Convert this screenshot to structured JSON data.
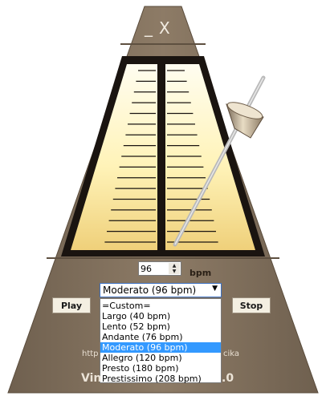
{
  "window": {
    "minimize_label": "_",
    "close_label": "X"
  },
  "tempo": {
    "value": "96",
    "unit": "bpm",
    "min_bpm": 40,
    "max_bpm": 208
  },
  "tempo_select": {
    "selected": "Moderato (96 bpm)",
    "arrow": "▼",
    "options": [
      "=Custom=",
      "Largo (40 bpm)",
      "Lento (52 bpm)",
      "Andante (76 bpm)",
      "Moderato (96 bpm)",
      "Allegro (120 bpm)",
      "Presto (180 bpm)",
      "Prestissimo (208 bpm)"
    ],
    "highlighted_index": 4
  },
  "buttons": {
    "play": "Play",
    "stop": "Stop"
  },
  "footer": {
    "website_visible_head": "http",
    "website_visible_tail": "cika",
    "title_visible_head": "Vin",
    "title_visible_tail": ".0"
  },
  "colors": {
    "body": "#85735f",
    "frame_dark": "#1a1410",
    "face_light": "#fffbd8",
    "face_warm": "#f1d27c",
    "highlight": "#3399ff",
    "arm_color": "#bdbdbd"
  }
}
